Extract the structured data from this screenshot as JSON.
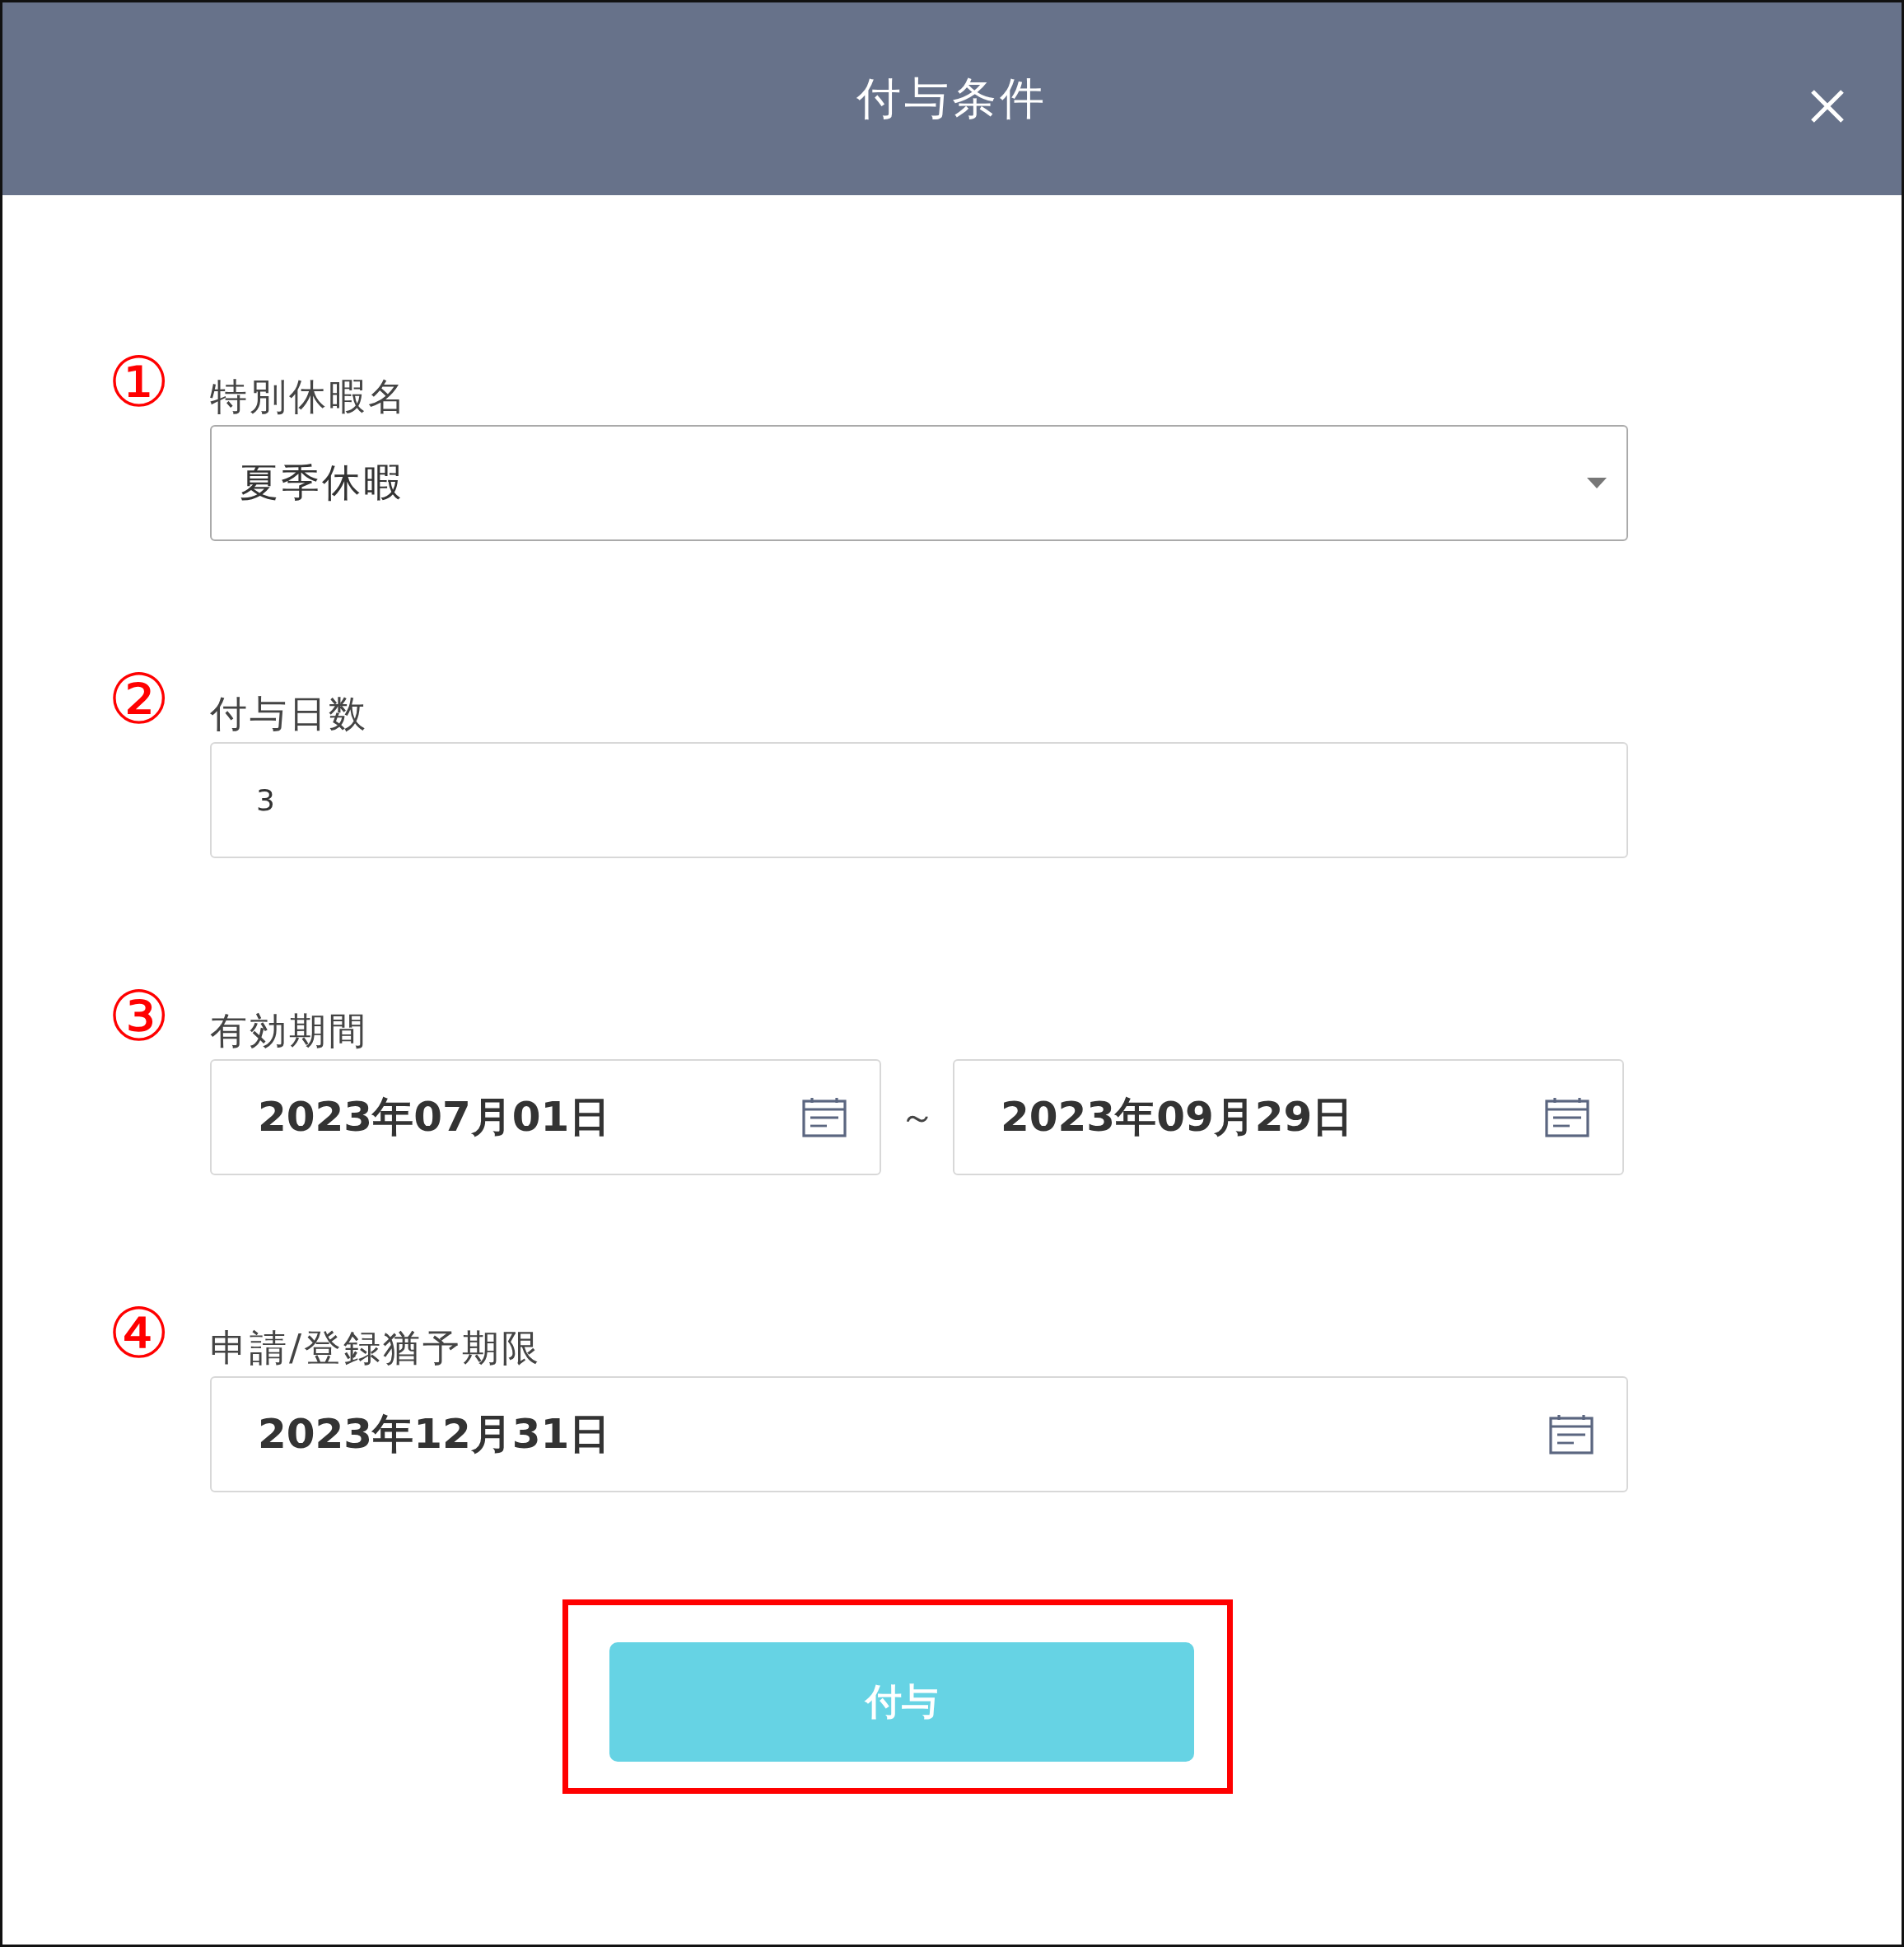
{
  "dialog": {
    "title": "付与条件"
  },
  "fields": [
    {
      "marker": "①",
      "label": "特別休暇名",
      "kind": "select",
      "value": "夏季休暇"
    },
    {
      "marker": "②",
      "label": "付与日数",
      "kind": "text",
      "value": "3"
    },
    {
      "marker": "③",
      "label": "有効期間",
      "kind": "date_range",
      "value": "2023年07月01日",
      "separator": "～",
      "value_end": "2023年09月29日"
    },
    {
      "marker": "④",
      "label": "申請/登録猶予期限",
      "kind": "date",
      "value": "2023年12月31日"
    }
  ],
  "submit_button": {
    "label": "付与",
    "highlighted": true
  }
}
